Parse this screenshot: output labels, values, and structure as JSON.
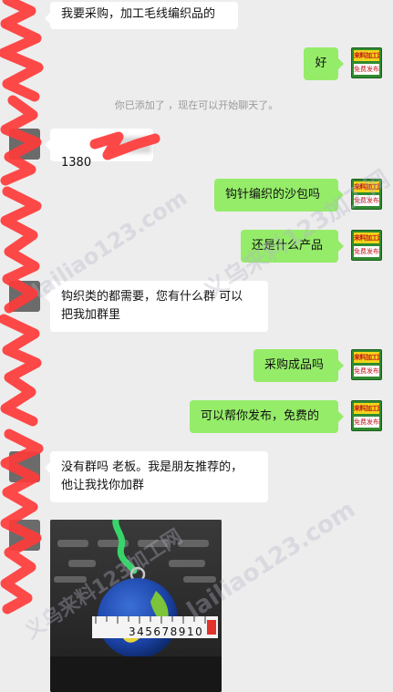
{
  "messages": {
    "m1": "我要采购，加工毛线编织品的",
    "m2": "好",
    "system_notice": "你已添加了 ，现在可以开始聊天了。",
    "m3": "1380",
    "m4": "钩针编织的沙包吗",
    "m5": "还是什么产品",
    "m6": "钩织类的都需要，您有什么群 可以\n把我加群里",
    "m7": "采购成品吗",
    "m8": "可以帮你发布，免费的",
    "m9": "没有群吗 老板。我是朋友推荐的，\n他让我找你加群"
  },
  "avatar_badge": {
    "top": "来料加工网",
    "bottom": "免费发布"
  },
  "photo": {
    "ruler_digits": "345678910"
  },
  "watermark": {
    "text_cn": "义乌来料123加工网",
    "text_en": "lailiao123.com"
  },
  "colors": {
    "bg": "#ededed",
    "bubble_out": "#95ec69",
    "bubble_in": "#ffffff",
    "scribble": "#ff3b3b"
  }
}
